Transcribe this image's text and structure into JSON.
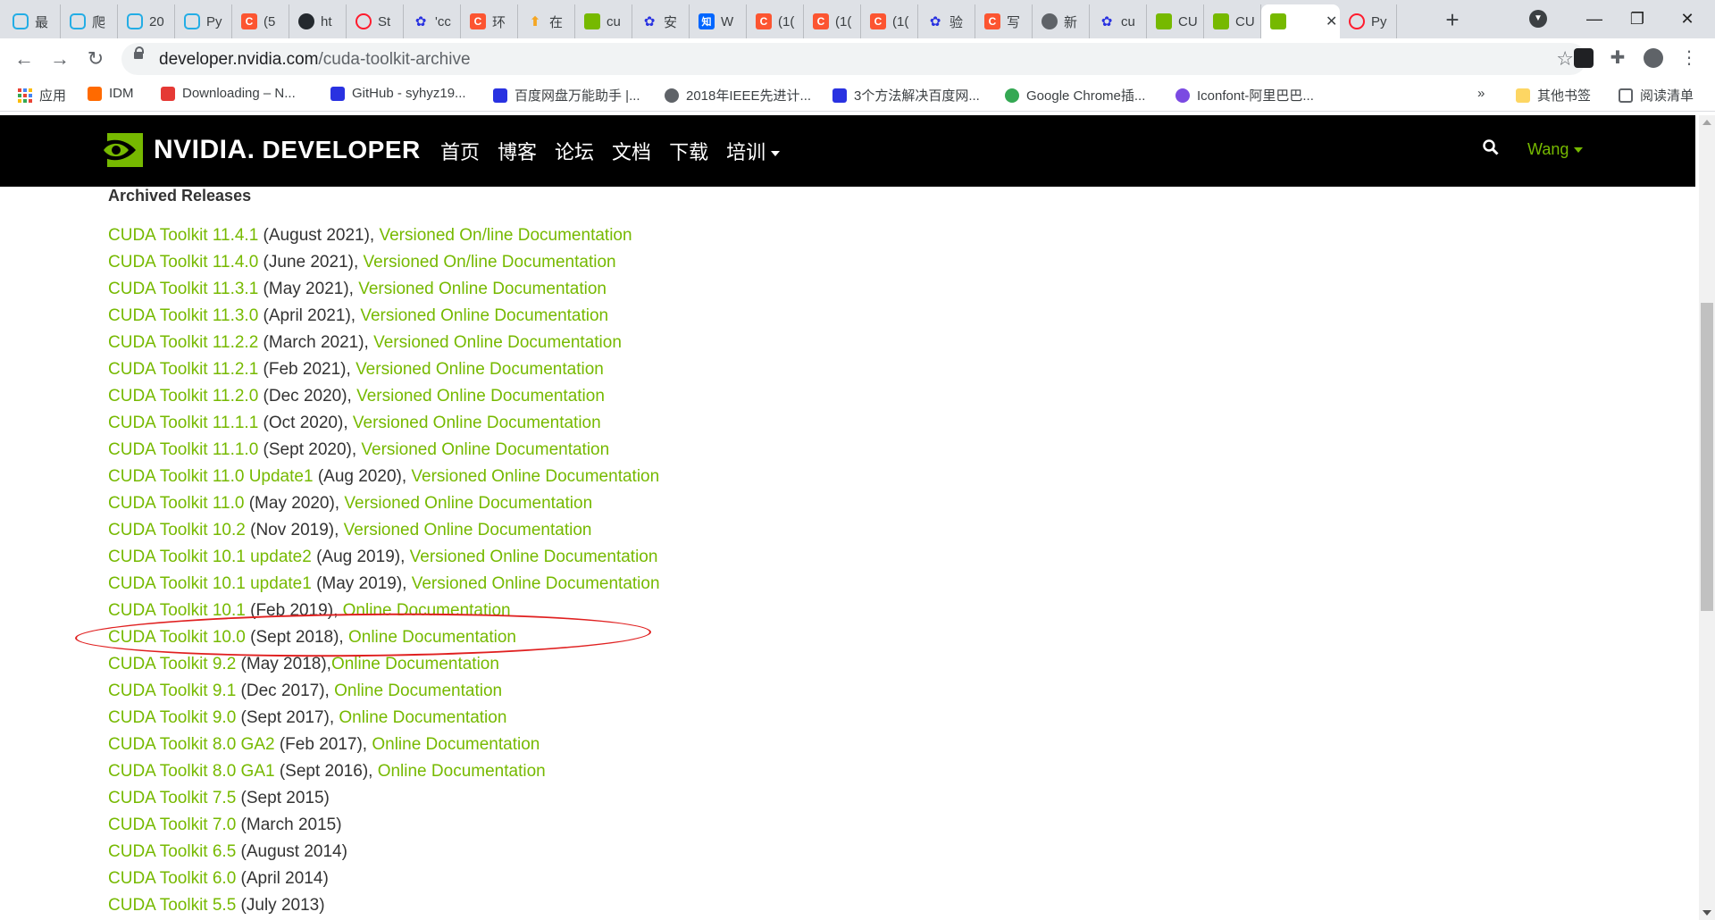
{
  "browser": {
    "tabs": [
      {
        "title": "最",
        "icon": "bilibili-icon",
        "color": "#23ade5"
      },
      {
        "title": "爬",
        "icon": "bilibili-icon",
        "color": "#23ade5"
      },
      {
        "title": "20",
        "icon": "bilibili-icon",
        "color": "#23ade5"
      },
      {
        "title": "Py",
        "icon": "bilibili-icon",
        "color": "#23ade5"
      },
      {
        "title": "(5",
        "icon": "csdn-icon",
        "color": "#fc5531"
      },
      {
        "title": "ht",
        "icon": "github-icon",
        "color": "#24292e"
      },
      {
        "title": "St",
        "icon": "opera-icon",
        "color": "#ff1b2d"
      },
      {
        "title": "'cc",
        "icon": "baidu-paw-icon",
        "color": "#2932e1"
      },
      {
        "title": "环",
        "icon": "csdn-icon",
        "color": "#fc5531"
      },
      {
        "title": "在",
        "icon": "arrow-up-icon",
        "color": "#f5a623"
      },
      {
        "title": "cu",
        "icon": "nvidia-icon",
        "color": "#76b900"
      },
      {
        "title": "安",
        "icon": "baidu-paw-icon",
        "color": "#2932e1"
      },
      {
        "title": "W",
        "icon": "zhihu-icon",
        "color": "#0066ff"
      },
      {
        "title": "(1(",
        "icon": "csdn-icon",
        "color": "#fc5531"
      },
      {
        "title": "(1(",
        "icon": "csdn-icon",
        "color": "#fc5531"
      },
      {
        "title": "(1(",
        "icon": "csdn-icon",
        "color": "#fc5531"
      },
      {
        "title": "验",
        "icon": "baidu-paw-icon",
        "color": "#2932e1"
      },
      {
        "title": "写",
        "icon": "csdn-icon",
        "color": "#fc5531"
      },
      {
        "title": "新",
        "icon": "chrome-icon",
        "color": "#5f6368"
      },
      {
        "title": "cu",
        "icon": "baidu-paw-icon",
        "color": "#2932e1"
      },
      {
        "title": "CU",
        "icon": "nvidia-icon",
        "color": "#76b900"
      },
      {
        "title": "CU",
        "icon": "nvidia-icon",
        "color": "#76b900"
      },
      {
        "title": "",
        "icon": "nvidia-icon",
        "color": "#76b900",
        "active": true
      },
      {
        "title": "Py",
        "icon": "opera-icon",
        "color": "#ff1b2d"
      }
    ],
    "url_host": "developer.nvidia.com",
    "url_path": "/cuda-toolkit-archive",
    "bookmarks": [
      {
        "label": "应用",
        "icon": "apps-grid-icon"
      },
      {
        "label": "IDM",
        "icon": "idm-icon"
      },
      {
        "label": "Downloading – N...",
        "icon": "n-logo-icon"
      },
      {
        "label": "GitHub - syhyz19...",
        "icon": "baidu-paw-icon"
      },
      {
        "label": "百度网盘万能助手 |...",
        "icon": "baidu-paw-icon"
      },
      {
        "label": "2018年IEEE先进计...",
        "icon": "globe-icon"
      },
      {
        "label": "3个方法解决百度网...",
        "icon": "baidu-paw-icon"
      },
      {
        "label": "Google Chrome插...",
        "icon": "chrome-icon"
      },
      {
        "label": "Iconfont-阿里巴巴...",
        "icon": "iconfont-icon"
      }
    ],
    "overflow_label": "»",
    "other_bookmarks": "其他书签",
    "reading_list": "阅读清单"
  },
  "site": {
    "logo_brand": "NVIDIA.",
    "logo_developer": "DEVELOPER",
    "nav": [
      "首页",
      "博客",
      "论坛",
      "文档",
      "下载",
      "培训"
    ],
    "user": "Wang",
    "accent": "#76b900"
  },
  "content": {
    "section_title": "Archived Releases",
    "releases": [
      {
        "toolkit": "CUDA Toolkit 11.4.1",
        "date": " (August 2021), ",
        "doc": "Versioned On/line Documentation"
      },
      {
        "toolkit": "CUDA Toolkit 11.4.0",
        "date": " (June 2021), ",
        "doc": "Versioned On/line Documentation"
      },
      {
        "toolkit": "CUDA Toolkit 11.3.1",
        "date": " (May 2021), ",
        "doc": "Versioned Online Documentation"
      },
      {
        "toolkit": "CUDA Toolkit 11.3.0",
        "date": " (April 2021), ",
        "doc": "Versioned Online Documentation"
      },
      {
        "toolkit": "CUDA Toolkit 11.2.2",
        "date": " (March 2021), ",
        "doc": "Versioned Online Documentation"
      },
      {
        "toolkit": "CUDA Toolkit 11.2.1",
        "date": " (Feb 2021), ",
        "doc": "Versioned Online Documentation"
      },
      {
        "toolkit": "CUDA Toolkit 11.2.0",
        "date": " (Dec 2020), ",
        "doc": "Versioned Online Documentation"
      },
      {
        "toolkit": "CUDA Toolkit 11.1.1",
        "date": " (Oct 2020), ",
        "doc": "Versioned Online Documentation"
      },
      {
        "toolkit": "CUDA Toolkit 11.1.0",
        "date": " (Sept 2020), ",
        "doc": "Versioned Online Documentation"
      },
      {
        "toolkit": "CUDA Toolkit 11.0 Update1",
        "date": " (Aug 2020), ",
        "doc": "Versioned Online Documentation"
      },
      {
        "toolkit": "CUDA Toolkit 11.0",
        "date": " (May 2020), ",
        "doc": "Versioned Online Documentation"
      },
      {
        "toolkit": "CUDA Toolkit 10.2",
        "date": " (Nov 2019), ",
        "doc": "Versioned Online Documentation"
      },
      {
        "toolkit": "CUDA Toolkit 10.1 update2",
        "date": " (Aug 2019), ",
        "doc": "Versioned Online Documentation"
      },
      {
        "toolkit": "CUDA Toolkit 10.1 update1",
        "date": " (May 2019), ",
        "doc": "Versioned Online Documentation"
      },
      {
        "toolkit": "CUDA Toolkit 10.1",
        "date": " (Feb 2019), ",
        "doc": "Online Documentation"
      },
      {
        "toolkit": "CUDA Toolkit 10.0",
        "date": " (Sept 2018), ",
        "doc": "Online Documentation"
      },
      {
        "toolkit": "CUDA Toolkit 9.2",
        "date": " (May 2018),",
        "doc": "Online Documentation"
      },
      {
        "toolkit": "CUDA Toolkit 9.1",
        "date": " (Dec 2017), ",
        "doc": "Online Documentation"
      },
      {
        "toolkit": "CUDA Toolkit 9.0",
        "date": " (Sept 2017), ",
        "doc": "Online Documentation"
      },
      {
        "toolkit": "CUDA Toolkit 8.0 GA2",
        "date": " (Feb 2017), ",
        "doc": "Online Documentation"
      },
      {
        "toolkit": "CUDA Toolkit 8.0 GA1",
        "date": " (Sept 2016), ",
        "doc": "Online Documentation"
      },
      {
        "toolkit": "CUDA Toolkit 7.5",
        "date": " (Sept 2015)",
        "doc": ""
      },
      {
        "toolkit": "CUDA Toolkit 7.0",
        "date": " (March 2015)",
        "doc": ""
      },
      {
        "toolkit": "CUDA Toolkit 6.5",
        "date": " (August 2014)",
        "doc": ""
      },
      {
        "toolkit": "CUDA Toolkit 6.0",
        "date": " (April 2014)",
        "doc": ""
      },
      {
        "toolkit": "CUDA Toolkit 5.5",
        "date": " (July 2013)",
        "doc": ""
      }
    ],
    "highlight_color": "#e02020"
  }
}
